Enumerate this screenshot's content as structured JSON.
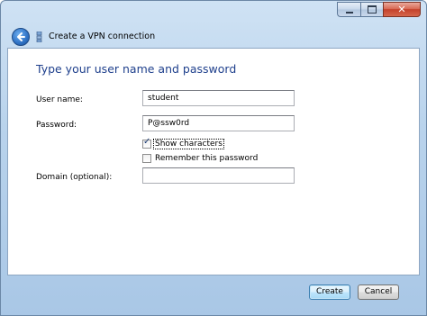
{
  "window": {
    "controls": {
      "minimize_icon": "minimize-icon",
      "maximize_icon": "maximize-icon",
      "close_icon": "close-icon"
    }
  },
  "header": {
    "back_icon": "back-arrow-icon",
    "app_icon": "vpn-network-icon",
    "title": "Create a VPN connection"
  },
  "page": {
    "heading": "Type your user name and password"
  },
  "form": {
    "username": {
      "label": "User name:",
      "value": "student"
    },
    "password": {
      "label": "Password:",
      "value": "P@ssw0rd"
    },
    "show_characters": {
      "label": "Show characters",
      "checked": true
    },
    "remember_password": {
      "label": "Remember this password",
      "checked": false
    },
    "domain": {
      "label": "Domain (optional):",
      "value": ""
    }
  },
  "buttons": {
    "create": "Create",
    "cancel": "Cancel"
  },
  "colors": {
    "heading": "#1e3f8c",
    "frame": "#b9d3ec",
    "close_button": "#c4412a"
  }
}
